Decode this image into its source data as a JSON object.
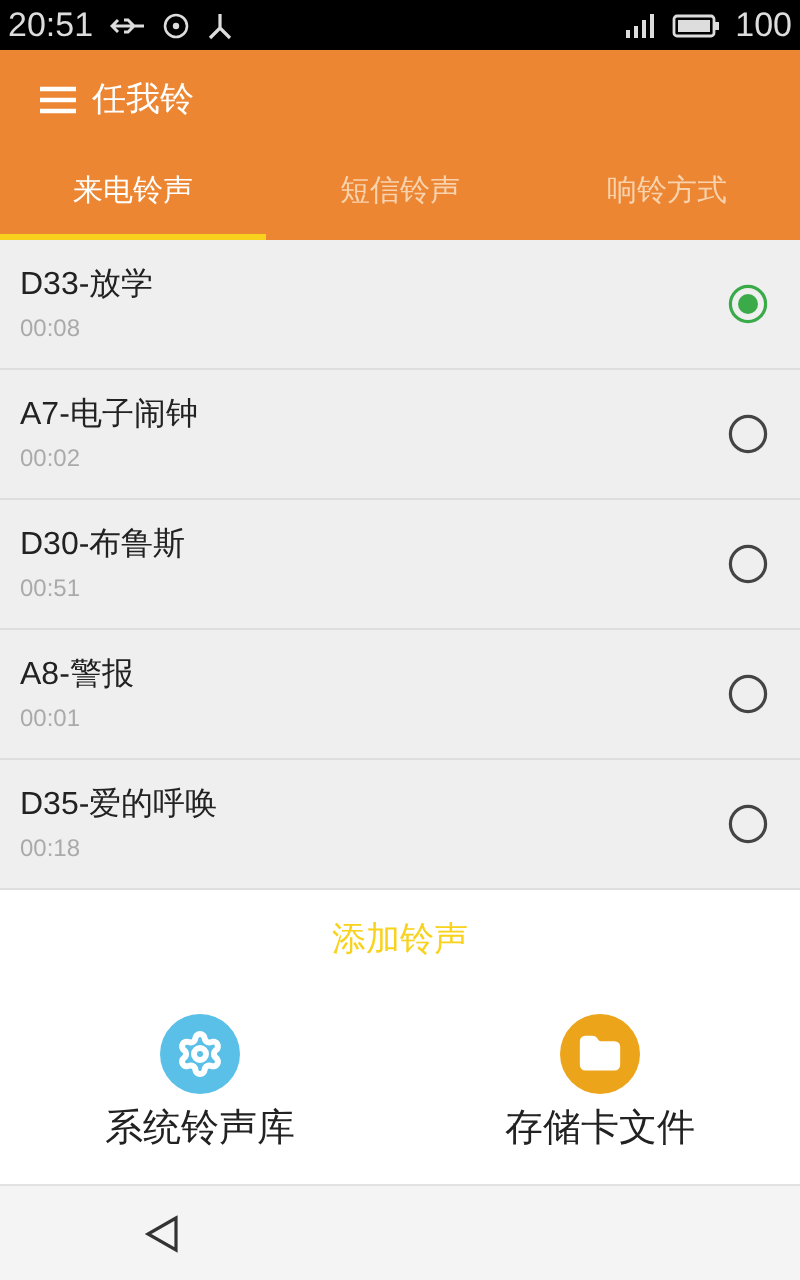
{
  "status_bar": {
    "time": "20:51",
    "battery": "100"
  },
  "app_bar": {
    "title": "任我铃"
  },
  "tabs": [
    {
      "label": "来电铃声",
      "selected": true
    },
    {
      "label": "短信铃声",
      "selected": false
    },
    {
      "label": "响铃方式",
      "selected": false
    }
  ],
  "ringtones": [
    {
      "name": "D33-放学",
      "duration": "00:08",
      "selected": true
    },
    {
      "name": "A7-电子闹钟",
      "duration": "00:02",
      "selected": false
    },
    {
      "name": "D30-布鲁斯",
      "duration": "00:51",
      "selected": false
    },
    {
      "name": "A8-警报",
      "duration": "00:01",
      "selected": false
    },
    {
      "name": "D35-爱的呼唤",
      "duration": "00:18",
      "selected": false
    }
  ],
  "add_button": "添加铃声",
  "sources": [
    {
      "kind": "system",
      "label": "系统铃声库"
    },
    {
      "kind": "storage",
      "label": "存储卡文件"
    }
  ]
}
